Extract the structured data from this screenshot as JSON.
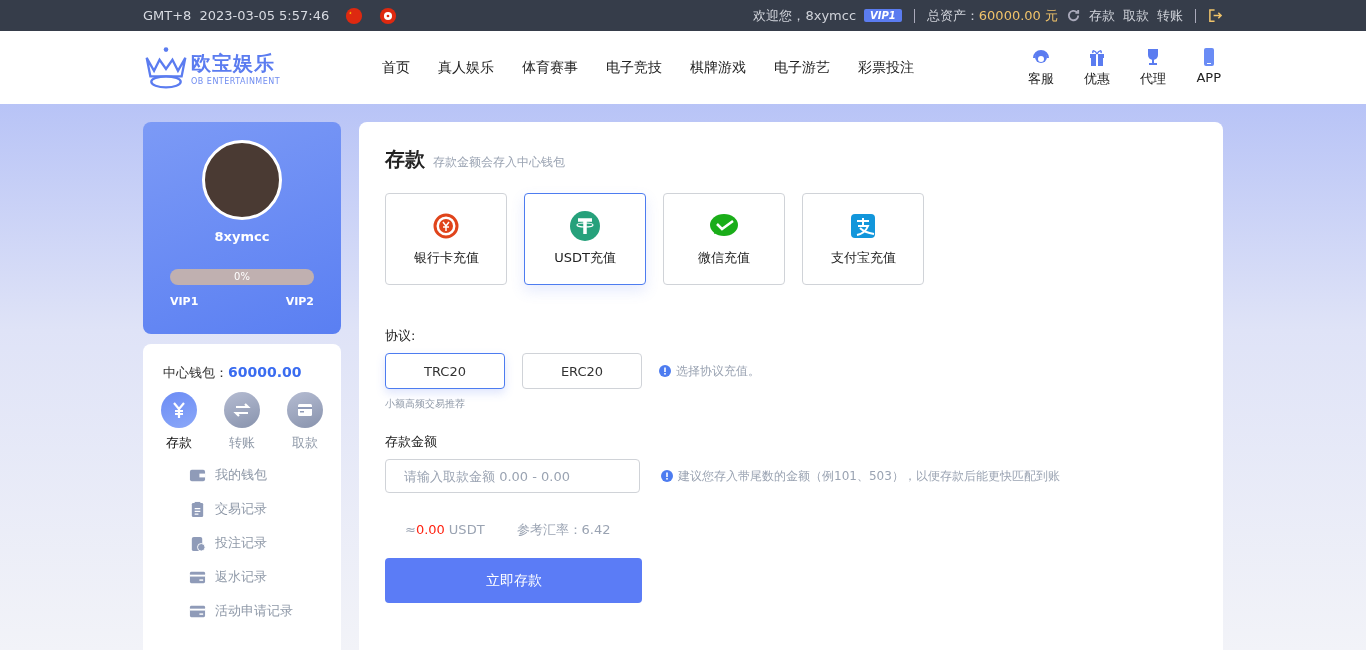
{
  "top_bar": {
    "timezone": "GMT+8",
    "datetime": "2023-03-05 5:57:46",
    "welcome": "欢迎您，8xymcc",
    "vip_badge": "VIP1",
    "assets_label": "总资产：",
    "assets_value": "60000.00 元",
    "links": [
      "存款",
      "取款",
      "转账"
    ]
  },
  "header": {
    "logo_name": "欧宝娱乐",
    "logo_sub": "OB ENTERTAINMENT",
    "nav": [
      "首页",
      "真人娱乐",
      "体育赛事",
      "电子竞技",
      "棋牌游戏",
      "电子游艺",
      "彩票投注"
    ],
    "quick_links": [
      {
        "kind": "support",
        "label": "客服"
      },
      {
        "kind": "gift",
        "label": "优惠"
      },
      {
        "kind": "trophy",
        "label": "代理"
      },
      {
        "kind": "phone",
        "label": "APP"
      }
    ]
  },
  "profile": {
    "username": "8xymcc",
    "progress": {
      "level": 0,
      "reading": "0%"
    },
    "vip_from": "VIP1",
    "vip_to": "VIP2"
  },
  "wallet": {
    "label": "中心钱包：",
    "value": "60000.00",
    "actions": [
      {
        "kind": "deposit",
        "label": "存款",
        "selected": true
      },
      {
        "kind": "transfer",
        "label": "转账",
        "selected": false
      },
      {
        "kind": "withdraw",
        "label": "取款",
        "selected": false
      }
    ],
    "menu": [
      {
        "kind": "wallet",
        "label": "我的钱包"
      },
      {
        "kind": "clipboard",
        "label": "交易记录"
      },
      {
        "kind": "bet",
        "label": "投注记录"
      },
      {
        "kind": "card",
        "label": "返水记录"
      },
      {
        "kind": "card",
        "label": "活动申请记录"
      }
    ]
  },
  "deposit": {
    "title": "存款",
    "subtitle": "存款金额会存入中心钱包",
    "methods": [
      {
        "kind": "bank",
        "label": "银行卡充值",
        "selected": false
      },
      {
        "kind": "usdt",
        "label": "USDT充值",
        "selected": true
      },
      {
        "kind": "wechat",
        "label": "微信充值",
        "selected": false
      },
      {
        "kind": "alipay",
        "label": "支付宝充值",
        "selected": false
      }
    ],
    "protocol_label": "协议:",
    "protocols": [
      {
        "label": "TRC20",
        "selected": true
      },
      {
        "label": "ERC20",
        "selected": false
      }
    ],
    "protocol_hint": "选择协议充值。",
    "protocol_note": "小额高频交易推荐",
    "amount_label": "存款金额",
    "amount_placeholder": "请输入取款金额 0.00 - 0.00",
    "amount_hint": "建议您存入带尾数的金额（例101、503），以便存款后能更快匹配到账",
    "approx_prefix": "≈",
    "approx_value": "0.00",
    "approx_unit": "USDT",
    "rate": "参考汇率：6.42",
    "submit": "立即存款"
  }
}
